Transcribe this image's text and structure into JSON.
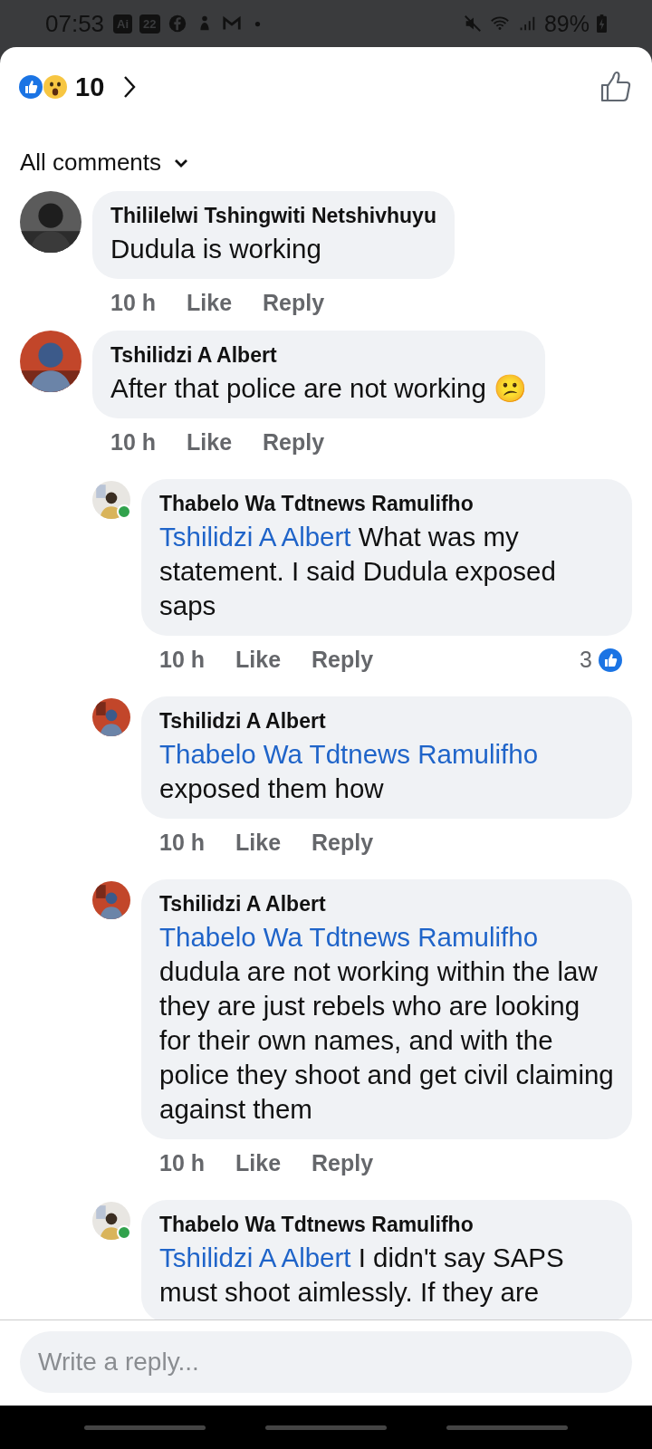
{
  "status_bar": {
    "time": "07:53",
    "app_badges": [
      "Ai",
      "22"
    ],
    "battery": "89%"
  },
  "header": {
    "reaction_count": "10"
  },
  "filter": {
    "label": "All comments"
  },
  "comments": [
    {
      "author": "Thililelwi Tshingwiti Netshivhuyu",
      "text": "Dudula is working",
      "time": "10 h",
      "like": "Like",
      "reply": "Reply",
      "online": false
    },
    {
      "author": "Tshilidzi A Albert",
      "text": "After that police are not working 😕",
      "time": "10 h",
      "like": "Like",
      "reply": "Reply",
      "online": false,
      "replies": [
        {
          "author": "Thabelo Wa Tdtnews Ramulifho",
          "mention": "Tshilidzi A Albert",
          "text": "What was my statement. I said Dudula exposed saps",
          "time": "10 h",
          "like": "Like",
          "reply": "Reply",
          "online": true,
          "likes": "3"
        },
        {
          "author": "Tshilidzi A Albert",
          "mention": "Thabelo Wa Tdtnews Ramulifho",
          "text": "exposed them how",
          "time": "10 h",
          "like": "Like",
          "reply": "Reply",
          "online": false
        },
        {
          "author": "Tshilidzi A Albert",
          "mention": "Thabelo Wa Tdtnews Ramulifho",
          "text": "dudula are not working within the law they are just rebels who are looking for their own names, and with the police they shoot and get civil claiming against them",
          "time": "10 h",
          "like": "Like",
          "reply": "Reply",
          "online": false
        },
        {
          "author": "Thabelo Wa Tdtnews Ramulifho",
          "mention": "Tshilidzi A Albert",
          "text": "I didn't say SAPS must shoot aimlessly. If they are",
          "online": true
        }
      ]
    }
  ],
  "composer": {
    "placeholder": "Write a reply..."
  }
}
